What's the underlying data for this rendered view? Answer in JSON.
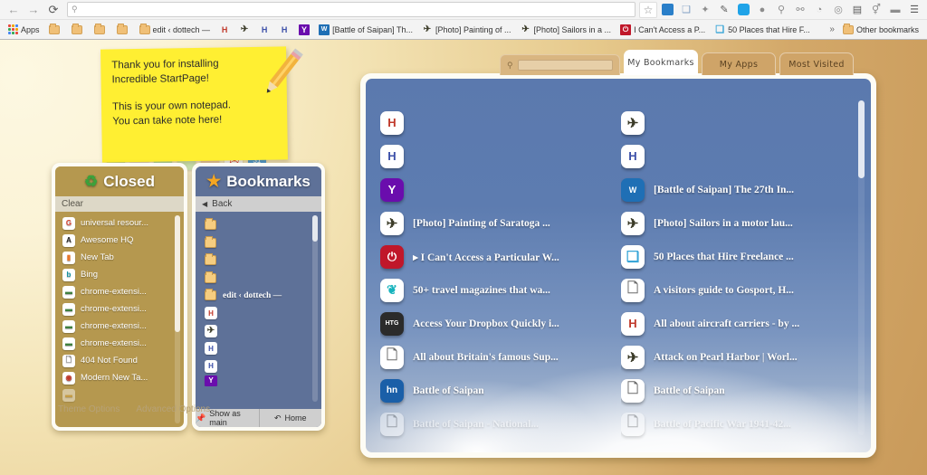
{
  "browser": {
    "nav": {
      "back": "←",
      "forward": "→",
      "reload": "⟳"
    },
    "omnibox": {
      "icon": "search-icon",
      "value": "",
      "placeholder": ""
    },
    "extensions": [
      {
        "name": "bookmark-star-icon",
        "glyph": "☆",
        "color": "#8d8d8d"
      },
      {
        "name": "incredible-startpage-icon",
        "glyph": "iS",
        "color": "#2a7fc9"
      },
      {
        "name": "windows-copy-icon",
        "glyph": "❐",
        "color": "#7f9fc4"
      },
      {
        "name": "puzzle-outline-icon",
        "glyph": "✧",
        "color": "#9a9a9a"
      },
      {
        "name": "paint-icon",
        "glyph": "✎",
        "color": "#6b6b6b"
      },
      {
        "name": "sync-refresh-icon",
        "glyph": "⟳",
        "color": "#1fa3e8"
      },
      {
        "name": "gray-circle-icon",
        "glyph": "●",
        "color": "#a9a9a9"
      },
      {
        "name": "wrench-icon",
        "glyph": "⚲",
        "color": "#8d8d8d"
      },
      {
        "name": "link-chain-icon",
        "glyph": "⚯",
        "color": "#8d8d8d"
      },
      {
        "name": "clock-icon",
        "glyph": "◔",
        "color": "#8d8d8d"
      },
      {
        "name": "target-circle-icon",
        "glyph": "◎",
        "color": "#a0a0a0"
      },
      {
        "name": "layout-panels-icon",
        "glyph": "▤",
        "color": "#6f6f6f"
      },
      {
        "name": "bulb-icon",
        "glyph": "♀",
        "color": "#8d8d8d"
      },
      {
        "name": "eraser-icon",
        "glyph": "▰",
        "color": "#8d8d8d"
      },
      {
        "name": "chrome-menu-icon",
        "glyph": "☰",
        "color": "#6f6f6f"
      }
    ],
    "bookmarks_bar": {
      "apps_label": "Apps",
      "overflow_glyph": "»",
      "other_bookmarks_label": "Other bookmarks",
      "items": [
        {
          "label": "",
          "icon": "folder-icon",
          "type": "folder"
        },
        {
          "label": "",
          "icon": "folder-icon",
          "type": "folder"
        },
        {
          "label": "",
          "icon": "folder-icon",
          "type": "folder"
        },
        {
          "label": "",
          "icon": "folder-icon",
          "type": "folder"
        },
        {
          "label": "edit ‹ dottech —",
          "icon": "folder-icon",
          "type": "folder"
        },
        {
          "label": "",
          "icon": "hf-red-icon",
          "glyph": "H",
          "color": "#c0392b",
          "type": "link"
        },
        {
          "label": "",
          "icon": "airplane-icon",
          "glyph": "✈",
          "color": "#3b3b28",
          "type": "link"
        },
        {
          "label": "",
          "icon": "h-blue-icon",
          "glyph": "H",
          "color": "#3b4fa8",
          "type": "link"
        },
        {
          "label": "",
          "icon": "h-blue-icon",
          "glyph": "H",
          "color": "#3b4fa8",
          "type": "link"
        },
        {
          "label": "",
          "icon": "y-purple-icon",
          "glyph": "Y",
          "color": "#ffffff",
          "bg": "#6a0dad",
          "type": "link"
        },
        {
          "label": "[Battle of Saipan] Th...",
          "icon": "ww-blue-icon",
          "glyph": "W",
          "color": "#ffffff",
          "bg": "#1f6fb5",
          "type": "link"
        },
        {
          "label": "[Photo] Painting of ...",
          "icon": "airplane-icon",
          "glyph": "✈",
          "color": "#3b3b28",
          "type": "link"
        },
        {
          "label": "[Photo] Sailors in a ...",
          "icon": "airplane-icon",
          "glyph": "✈",
          "color": "#3b3b28",
          "type": "link"
        },
        {
          "label": "I Can't Access a P...",
          "icon": "power-red-icon",
          "glyph": "⏻",
          "color": "#ffffff",
          "bg": "#c0172a",
          "type": "link",
          "prefix": "▶"
        },
        {
          "label": "50 Places that Hire F...",
          "icon": "book-icon",
          "glyph": "❙",
          "color": "#3aa6d8",
          "type": "link"
        }
      ]
    }
  },
  "sticky_note": {
    "name": "notepad-sticky-note",
    "lines_top": [
      "Thank you for installing",
      "Incredible StartPage!"
    ],
    "lines_bottom": [
      "This is your own notepad.",
      "You can take note here!"
    ],
    "color": "#ffef32"
  },
  "color_chips": [
    "#c5d9a0",
    "#efe3c0",
    "#b9e0a8",
    "#cfe8b6",
    "#f0cfa8",
    "#ffffff",
    "#4a9ddb"
  ],
  "closed_panel": {
    "title": "Closed",
    "icon": "recycle-icon",
    "clear_label": "Clear",
    "items": [
      {
        "label": "universal resour...",
        "icon": "google-icon",
        "glyph": "G",
        "color": "#d8402f"
      },
      {
        "label": "Awesome HQ",
        "icon": "awesome-icon",
        "glyph": "A",
        "color": "#222222"
      },
      {
        "label": "New Tab",
        "icon": "orange-tab-icon",
        "glyph": "▮",
        "color": "#e8762a"
      },
      {
        "label": "Bing",
        "icon": "bing-icon",
        "glyph": "b",
        "color": "#0e8f9e"
      },
      {
        "label": "chrome-extensi...",
        "icon": "chrome-extension-icon",
        "glyph": "▬",
        "color": "#3f7f3f"
      },
      {
        "label": "chrome-extensi...",
        "icon": "chrome-extension-icon",
        "glyph": "▬",
        "color": "#3f7f3f"
      },
      {
        "label": "chrome-extensi...",
        "icon": "chrome-extension-icon",
        "glyph": "▬",
        "color": "#3f7f3f"
      },
      {
        "label": "chrome-extensi...",
        "icon": "chrome-extension-icon",
        "glyph": "▬",
        "color": "#3f7f3f"
      },
      {
        "label": "404 Not Found",
        "icon": "document-icon",
        "glyph": "🗋",
        "color": "#777777"
      },
      {
        "label": "Modern New Ta...",
        "icon": "chrome-icon",
        "glyph": "◉",
        "color": "#c0392b"
      },
      {
        "label": "",
        "icon": "partial-icon",
        "glyph": "▬",
        "color": "#d8a13a"
      }
    ]
  },
  "bookmarks_panel": {
    "title": "Bookmarks",
    "icon": "star-icon",
    "back_label": "Back",
    "back_icon": "chevron-left-icon",
    "footer": {
      "show_as_main_label": "Show as main",
      "show_as_main_icon": "pin-icon",
      "home_label": "Home",
      "home_icon": "home-refresh-icon"
    },
    "items": [
      {
        "label": "",
        "icon": "folder-icon",
        "type": "folder"
      },
      {
        "label": "",
        "icon": "folder-icon",
        "type": "folder"
      },
      {
        "label": "",
        "icon": "folder-icon",
        "type": "folder"
      },
      {
        "label": "",
        "icon": "folder-icon",
        "type": "folder"
      },
      {
        "label": "edit ‹ dottech —",
        "icon": "folder-icon",
        "type": "folder"
      },
      {
        "label": "",
        "icon": "hf-red-icon",
        "glyph": "H",
        "color": "#c0392b",
        "type": "link"
      },
      {
        "label": "",
        "icon": "airplane-icon",
        "glyph": "✈",
        "color": "#3b3b28",
        "type": "link"
      },
      {
        "label": "",
        "icon": "h-blue-icon",
        "glyph": "H",
        "color": "#3b4fa8",
        "type": "link"
      },
      {
        "label": "",
        "icon": "h-blue-icon",
        "glyph": "H",
        "color": "#3b4fa8",
        "type": "link"
      },
      {
        "label": "",
        "icon": "y-purple-icon",
        "glyph": "Y",
        "color": "#ffffff",
        "bg": "#6a0dad",
        "type": "link"
      }
    ]
  },
  "options": {
    "theme_options_label": "Theme Options",
    "advanced_options_label": "Advanced Options"
  },
  "startpage": {
    "search": {
      "icon": "search-icon",
      "value": "",
      "placeholder": ""
    },
    "tabs": [
      {
        "label": "My Bookmarks",
        "active": true
      },
      {
        "label": "My Apps",
        "active": false
      },
      {
        "label": "Most Visited",
        "active": false
      }
    ],
    "bookmarks": [
      {
        "label": "",
        "icon": "hf-red-icon",
        "glyph": "H",
        "color": "#c0392b",
        "bg": "#ffffff"
      },
      {
        "label": "",
        "icon": "airplane-icon",
        "glyph": "✈",
        "color": "#3b3b28",
        "bg": "#ffffff"
      },
      {
        "label": "",
        "icon": "h-blue-icon",
        "glyph": "H",
        "color": "#3b4fa8",
        "bg": "#ffffff"
      },
      {
        "label": "",
        "icon": "h-blue-icon",
        "glyph": "H",
        "color": "#3b4fa8",
        "bg": "#ffffff"
      },
      {
        "label": "",
        "icon": "y-purple-icon",
        "glyph": "Y",
        "color": "#ffffff",
        "bg": "#6a0dad"
      },
      {
        "label": "[Battle of Saipan] The 27th In...",
        "icon": "ww-blue-icon",
        "glyph": "W",
        "color": "#ffffff",
        "bg": "#1f6fb5"
      },
      {
        "label": "[Photo] Painting of Saratoga ...",
        "icon": "airplane-icon",
        "glyph": "✈",
        "color": "#3b3b28",
        "bg": "#ffffff"
      },
      {
        "label": "[Photo] Sailors in a motor lau...",
        "icon": "airplane-icon",
        "glyph": "✈",
        "color": "#3b3b28",
        "bg": "#ffffff"
      },
      {
        "label": "▸ I Can't Access a Particular W...",
        "icon": "power-red-icon",
        "glyph": "⏻",
        "color": "#ffffff",
        "bg": "#c0172a"
      },
      {
        "label": "50 Places that Hire Freelance ...",
        "icon": "book-icon",
        "glyph": "❙",
        "color": "#3aa6d8",
        "bg": "#ffffff"
      },
      {
        "label": "50+ travel magazines that wa...",
        "icon": "teal-leaf-icon",
        "glyph": "❦",
        "color": "#17b3bd",
        "bg": "#ffffff"
      },
      {
        "label": "A visitors guide to Gosport, H...",
        "icon": "document-icon",
        "glyph": "🗋",
        "color": "#6d6d6d",
        "bg": "#ffffff"
      },
      {
        "label": "Access Your Dropbox Quickly i...",
        "icon": "htg-icon",
        "glyph": "HTG",
        "color": "#ffffff",
        "bg": "#2b2b2b"
      },
      {
        "label": "All about aircraft carriers - by ...",
        "icon": "hf-red-icon",
        "glyph": "H",
        "color": "#c0392b",
        "bg": "#ffffff"
      },
      {
        "label": "All about Britain's famous Sup...",
        "icon": "document-icon",
        "glyph": "🗋",
        "color": "#6d6d6d",
        "bg": "#ffffff"
      },
      {
        "label": "Attack on Pearl Harbor | Worl...",
        "icon": "airplane-icon",
        "glyph": "✈",
        "color": "#3b3b28",
        "bg": "#ffffff"
      },
      {
        "label": "Battle of Saipan",
        "icon": "hn-blue-icon",
        "glyph": "hn",
        "color": "#ffffff",
        "bg": "#1a5fa8"
      },
      {
        "label": "Battle of Saipan",
        "icon": "document-icon",
        "glyph": "🗋",
        "color": "#6d6d6d",
        "bg": "#ffffff"
      },
      {
        "label": "Battle of Saipan - National...",
        "icon": "document-icon",
        "glyph": "🗋",
        "color": "#6d6d6d",
        "bg": "#ffffff"
      },
      {
        "label": "Battle of Pacific War 1941-42...",
        "icon": "document-icon",
        "glyph": "🗋",
        "color": "#6d6d6d",
        "bg": "#ffffff"
      }
    ]
  }
}
